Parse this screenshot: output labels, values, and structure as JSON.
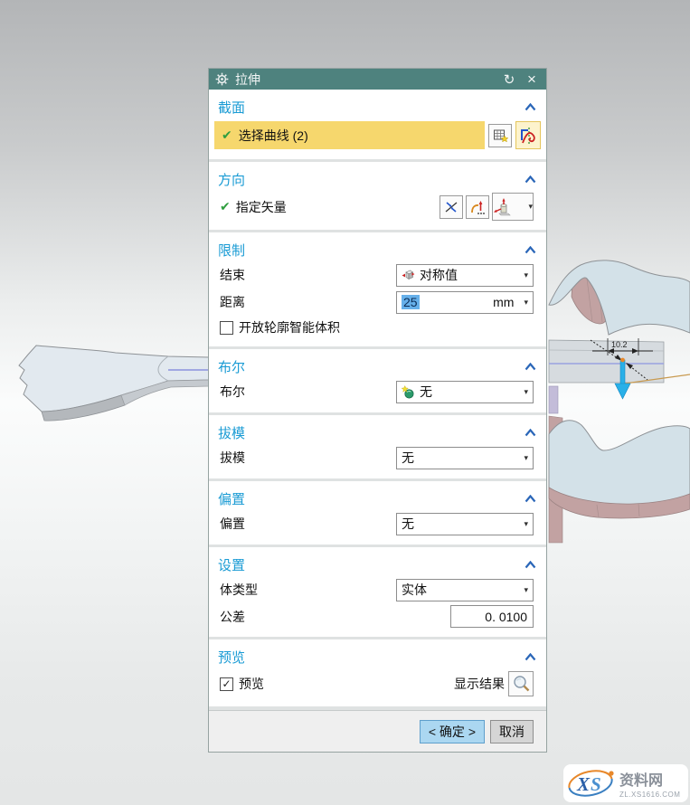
{
  "dialog": {
    "title": "拉伸",
    "titlebar_icons": {
      "reset": "↻",
      "close": "×"
    },
    "glyphs": {
      "check": "✔",
      "caret_down": "▾",
      "checkbox_check": "✓"
    },
    "section": {
      "header": "截面",
      "select_curve": "选择曲线 (2)"
    },
    "direction": {
      "header": "方向",
      "specify_vector": "指定矢量"
    },
    "limits": {
      "header": "限制",
      "end_label": "结束",
      "end_value": "对称值",
      "distance_label": "距离",
      "distance_value": "25",
      "distance_unit": "mm",
      "open_profile_label": "开放轮廓智能体积"
    },
    "boolean": {
      "header": "布尔",
      "label": "布尔",
      "value": "无"
    },
    "draft": {
      "header": "拔模",
      "label": "拔模",
      "value": "无"
    },
    "offset": {
      "header": "偏置",
      "label": "偏置",
      "value": "无"
    },
    "settings": {
      "header": "设置",
      "body_type_label": "体类型",
      "body_type_value": "实体",
      "tolerance_label": "公差",
      "tolerance_value": "0. 0100"
    },
    "preview": {
      "header": "预览",
      "preview_label": "预览",
      "show_result_label": "显示结果"
    },
    "buttons": {
      "ok": "< 确定 >",
      "cancel": "取消"
    }
  },
  "viewport": {
    "dimension_label": "10.2"
  },
  "watermark": {
    "logo": "XS",
    "site_name": "资料网",
    "site_url": "ZL.XS1616.COM"
  },
  "colors": {
    "titlebar": "#4e827e",
    "section_header": "#199bd4",
    "chevron": "#2a66b8",
    "selection_yellow": "#f6d76d",
    "ok_button": "#abd7f1",
    "distance_selection": "#66b0ea",
    "extrude_arrow": "#29b0e8",
    "model_top": "#d9e4ea",
    "model_wall_pink": "#c2a2a2"
  }
}
